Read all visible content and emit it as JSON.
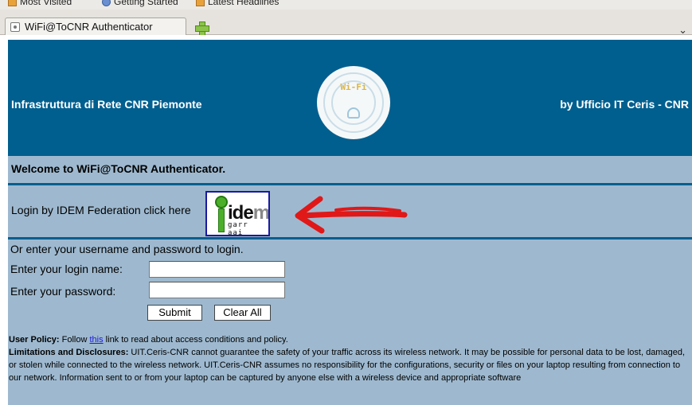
{
  "browser": {
    "bookmarks": [
      {
        "label": "Most Visited"
      },
      {
        "label": "Getting Started"
      },
      {
        "label": "Latest Headlines"
      }
    ],
    "tab_title": "WiFi@ToCNR Authenticator",
    "tab_menu_glyph": "⌄"
  },
  "header": {
    "left_title": "Infrastruttura di Rete CNR Piemonte",
    "logo_text": "Wi-Fi",
    "right_title": "by Ufficio IT Ceris - CNR"
  },
  "welcome": "Welcome to WiFi@ToCNR Authenticator.",
  "idem": {
    "label": "Login by IDEM Federation click here",
    "logo_word": "ide",
    "logo_word_tail": "m",
    "logo_sub": "garr aai"
  },
  "login": {
    "intro": "Or enter your username and password to login.",
    "login_label": "Enter your login name:",
    "password_label": "Enter your password:",
    "login_value": "",
    "password_value": "",
    "submit_label": "Submit",
    "clear_label": "Clear All"
  },
  "policy": {
    "user_policy_heading": "User Policy:",
    "user_policy_pre": " Follow ",
    "user_policy_link": "this",
    "user_policy_post": " link to read about access conditions and policy.",
    "limitations_heading": "Limitations and Disclosures:",
    "limitations_text": " UIT.Ceris-CNR cannot guarantee the safety of your traffic across its wireless network. It may be possible for personal data to be lost, damaged, or stolen while connected to the wireless network. UIT.Ceris-CNR assumes no responsibility for the configurations, security or files on your laptop resulting from connection to our network. Information sent to or from your laptop can be captured by anyone else with a wireless device and appropriate software"
  },
  "colors": {
    "header_bg": "#015f8f",
    "page_bg": "#9eb9cf",
    "arrow": "#e01818",
    "link": "#1a1adc"
  }
}
